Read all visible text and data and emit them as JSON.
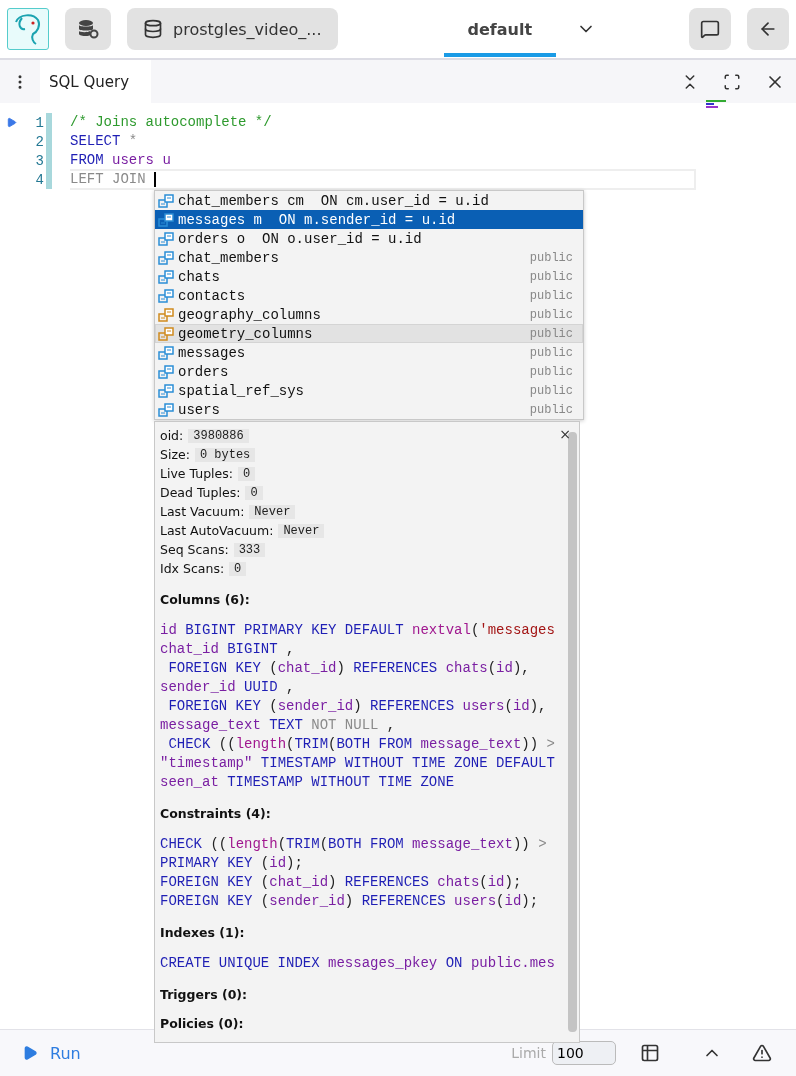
{
  "header": {
    "database": "prostgles_video_...",
    "workspace_tab": {
      "label": "default",
      "selected": true
    }
  },
  "window_tab": {
    "title": "SQL Query"
  },
  "editor": {
    "lines": [
      {
        "number": "1",
        "current": false,
        "tokens": [
          {
            "kind": "comment",
            "text": "/* Joins autocomplete */"
          }
        ]
      },
      {
        "number": "2",
        "current": false,
        "tokens": [
          {
            "kind": "kw",
            "text": "SELECT"
          },
          {
            "kind": "dim",
            "text": " *"
          }
        ]
      },
      {
        "number": "3",
        "current": false,
        "tokens": [
          {
            "kind": "kw",
            "text": "FROM"
          },
          {
            "kind": "id",
            "text": " users u"
          }
        ]
      },
      {
        "number": "4",
        "current": true,
        "tokens": [
          {
            "kind": "dim",
            "text": "LEFT JOIN "
          }
        ]
      }
    ]
  },
  "autocomplete": {
    "items": [
      {
        "label": "chat_members cm  ON cm.user_id = u.id",
        "kind": "table",
        "selected": false,
        "hovered": false
      },
      {
        "label": "messages m  ON m.sender_id = u.id",
        "kind": "table",
        "selected": true,
        "hovered": false
      },
      {
        "label": "orders o  ON o.user_id = u.id",
        "kind": "table",
        "selected": false,
        "hovered": false
      },
      {
        "label": "chat_members",
        "schema": "public",
        "kind": "table",
        "selected": false,
        "hovered": false
      },
      {
        "label": "chats",
        "schema": "public",
        "kind": "table",
        "selected": false,
        "hovered": false
      },
      {
        "label": "contacts",
        "schema": "public",
        "kind": "table",
        "selected": false,
        "hovered": false
      },
      {
        "label": "geography_columns",
        "schema": "public",
        "kind": "view",
        "selected": false,
        "hovered": false
      },
      {
        "label": "geometry_columns",
        "schema": "public",
        "kind": "view",
        "selected": false,
        "hovered": true
      },
      {
        "label": "messages",
        "schema": "public",
        "kind": "table",
        "selected": false,
        "hovered": false
      },
      {
        "label": "orders",
        "schema": "public",
        "kind": "table",
        "selected": false,
        "hovered": false
      },
      {
        "label": "spatial_ref_sys",
        "schema": "public",
        "kind": "table",
        "selected": false,
        "hovered": false
      },
      {
        "label": "users",
        "schema": "public",
        "kind": "table",
        "selected": false,
        "hovered": false
      }
    ]
  },
  "details": {
    "close": "×",
    "stats": [
      {
        "label": "oid:",
        "value": "3980886"
      },
      {
        "label": "Size:",
        "value": "0 bytes"
      },
      {
        "label": "Live Tuples:",
        "value": "0"
      },
      {
        "label": "Dead Tuples:",
        "value": "0"
      },
      {
        "label": "Last Vacuum:",
        "value": "Never"
      },
      {
        "label": "Last AutoVacuum:",
        "value": "Never"
      },
      {
        "label": "Seq Scans:",
        "value": "333"
      },
      {
        "label": "Idx Scans:",
        "value": "0"
      }
    ],
    "sections": [
      {
        "title": "Columns (6):",
        "lines": [
          [
            {
              "kind": "id",
              "text": "id "
            },
            {
              "kind": "kw",
              "text": "BIGINT PRIMARY KEY DEFAULT "
            },
            {
              "kind": "fn",
              "text": "nextval"
            },
            {
              "kind": "punct",
              "text": "("
            },
            {
              "kind": "str",
              "text": "'messages"
            }
          ],
          [
            {
              "kind": "id",
              "text": "chat_id "
            },
            {
              "kind": "kw",
              "text": "BIGINT"
            },
            {
              "kind": "punct",
              "text": " ,"
            }
          ],
          [
            {
              "kind": "kw",
              "text": " FOREIGN KEY "
            },
            {
              "kind": "punct",
              "text": "("
            },
            {
              "kind": "id",
              "text": "chat_id"
            },
            {
              "kind": "punct",
              "text": ") "
            },
            {
              "kind": "kw",
              "text": "REFERENCES "
            },
            {
              "kind": "id",
              "text": "chats"
            },
            {
              "kind": "punct",
              "text": "("
            },
            {
              "kind": "id",
              "text": "id"
            },
            {
              "kind": "punct",
              "text": "),"
            }
          ],
          [
            {
              "kind": "id",
              "text": "sender_id "
            },
            {
              "kind": "kw",
              "text": "UUID"
            },
            {
              "kind": "punct",
              "text": " ,"
            }
          ],
          [
            {
              "kind": "kw",
              "text": " FOREIGN KEY "
            },
            {
              "kind": "punct",
              "text": "("
            },
            {
              "kind": "id",
              "text": "sender_id"
            },
            {
              "kind": "punct",
              "text": ") "
            },
            {
              "kind": "kw",
              "text": "REFERENCES "
            },
            {
              "kind": "id",
              "text": "users"
            },
            {
              "kind": "punct",
              "text": "("
            },
            {
              "kind": "id",
              "text": "id"
            },
            {
              "kind": "punct",
              "text": "),"
            }
          ],
          [
            {
              "kind": "id",
              "text": "message_text "
            },
            {
              "kind": "kw",
              "text": "TEXT "
            },
            {
              "kind": "dim",
              "text": "NOT NULL"
            },
            {
              "kind": "punct",
              "text": " ,"
            }
          ],
          [
            {
              "kind": "kw",
              "text": " CHECK "
            },
            {
              "kind": "punct",
              "text": "(("
            },
            {
              "kind": "fn",
              "text": "length"
            },
            {
              "kind": "punct",
              "text": "("
            },
            {
              "kind": "kw",
              "text": "TRIM"
            },
            {
              "kind": "punct",
              "text": "("
            },
            {
              "kind": "kw",
              "text": "BOTH FROM "
            },
            {
              "kind": "id",
              "text": "message_text"
            },
            {
              "kind": "punct",
              "text": ")) "
            },
            {
              "kind": "dim",
              "text": ">"
            }
          ],
          [
            {
              "kind": "id",
              "text": "\"timestamp\" "
            },
            {
              "kind": "kw",
              "text": "TIMESTAMP WITHOUT TIME ZONE DEFAULT"
            }
          ],
          [
            {
              "kind": "id",
              "text": "seen_at "
            },
            {
              "kind": "kw",
              "text": "TIMESTAMP WITHOUT TIME ZONE"
            }
          ]
        ]
      },
      {
        "title": "Constraints (4):",
        "lines": [
          [
            {
              "kind": "kw",
              "text": "CHECK "
            },
            {
              "kind": "punct",
              "text": "(("
            },
            {
              "kind": "fn",
              "text": "length"
            },
            {
              "kind": "punct",
              "text": "("
            },
            {
              "kind": "kw",
              "text": "TRIM"
            },
            {
              "kind": "punct",
              "text": "("
            },
            {
              "kind": "kw",
              "text": "BOTH FROM "
            },
            {
              "kind": "id",
              "text": "message_text"
            },
            {
              "kind": "punct",
              "text": ")) "
            },
            {
              "kind": "dim",
              "text": ">"
            }
          ],
          [
            {
              "kind": "kw",
              "text": "PRIMARY KEY "
            },
            {
              "kind": "punct",
              "text": "("
            },
            {
              "kind": "id",
              "text": "id"
            },
            {
              "kind": "punct",
              "text": ");"
            }
          ],
          [
            {
              "kind": "kw",
              "text": "FOREIGN KEY "
            },
            {
              "kind": "punct",
              "text": "("
            },
            {
              "kind": "id",
              "text": "chat_id"
            },
            {
              "kind": "punct",
              "text": ") "
            },
            {
              "kind": "kw",
              "text": "REFERENCES "
            },
            {
              "kind": "id",
              "text": "chats"
            },
            {
              "kind": "punct",
              "text": "("
            },
            {
              "kind": "id",
              "text": "id"
            },
            {
              "kind": "punct",
              "text": ");"
            }
          ],
          [
            {
              "kind": "kw",
              "text": "FOREIGN KEY "
            },
            {
              "kind": "punct",
              "text": "("
            },
            {
              "kind": "id",
              "text": "sender_id"
            },
            {
              "kind": "punct",
              "text": ") "
            },
            {
              "kind": "kw",
              "text": "REFERENCES "
            },
            {
              "kind": "id",
              "text": "users"
            },
            {
              "kind": "punct",
              "text": "("
            },
            {
              "kind": "id",
              "text": "id"
            },
            {
              "kind": "punct",
              "text": ");"
            }
          ]
        ]
      },
      {
        "title": "Indexes (1):",
        "lines": [
          [
            {
              "kind": "kw",
              "text": "CREATE UNIQUE INDEX "
            },
            {
              "kind": "id",
              "text": "messages_pkey "
            },
            {
              "kind": "kw",
              "text": "ON "
            },
            {
              "kind": "id",
              "text": "public.mes"
            }
          ]
        ]
      },
      {
        "title": "Triggers (0):"
      },
      {
        "title": "Policies (0):"
      }
    ]
  },
  "footer": {
    "run": "Run",
    "limit_label": "Limit",
    "limit_value": "100"
  }
}
